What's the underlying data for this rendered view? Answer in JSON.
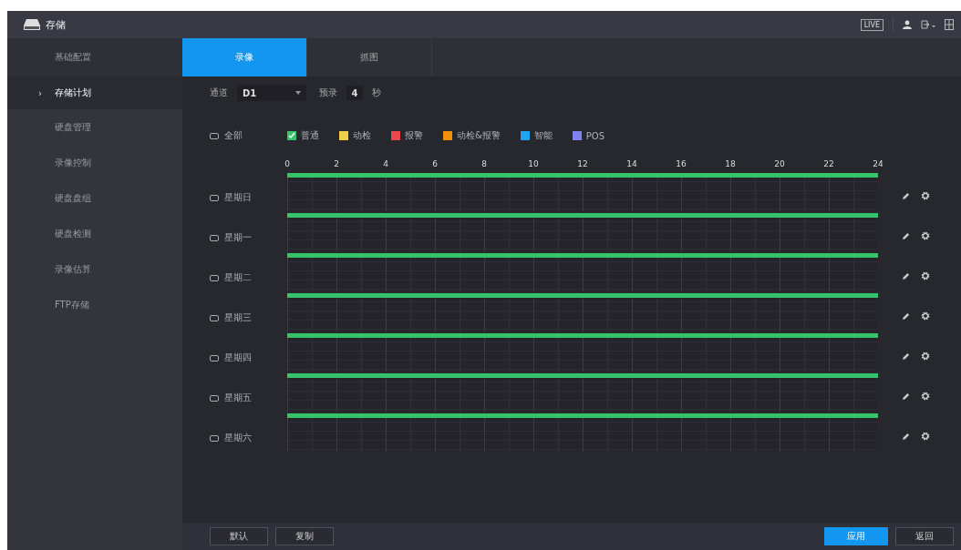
{
  "header": {
    "title": "存储",
    "live_label": "LIVE"
  },
  "sidebar": {
    "selected_marker": "›",
    "items": [
      {
        "label": "基础配置",
        "selected": false
      },
      {
        "label": "存储计划",
        "selected": true
      },
      {
        "label": "硬盘管理",
        "selected": false
      },
      {
        "label": "录像控制",
        "selected": false
      },
      {
        "label": "硬盘盘组",
        "selected": false
      },
      {
        "label": "硬盘检测",
        "selected": false
      },
      {
        "label": "录像估算",
        "selected": false
      },
      {
        "label": "FTP存储",
        "selected": false
      }
    ]
  },
  "tabs": [
    {
      "label": "录像",
      "selected": true
    },
    {
      "label": "抓图",
      "selected": false
    }
  ],
  "channel": {
    "label": "通道",
    "value": "D1",
    "prerecord_label": "预录",
    "prerecord_value": "4",
    "unit": "秒"
  },
  "select_all": {
    "label": "全部",
    "checked": false
  },
  "legend": [
    {
      "label": "普通",
      "color": "#35c46a",
      "checked": true
    },
    {
      "label": "动检",
      "color": "#f0cf4a",
      "checked": false
    },
    {
      "label": "报警",
      "color": "#e8474c",
      "checked": false
    },
    {
      "label": "动检&报警",
      "color": "#f2900c",
      "checked": false
    },
    {
      "label": "智能",
      "color": "#1ea4f0",
      "checked": false
    },
    {
      "label": "POS",
      "color": "#7f82f2",
      "checked": false
    }
  ],
  "axis_labels": [
    "0",
    "2",
    "4",
    "6",
    "8",
    "10",
    "12",
    "14",
    "16",
    "18",
    "20",
    "22",
    "24"
  ],
  "days": [
    {
      "label": "星期日",
      "checked": false,
      "level": 1
    },
    {
      "label": "星期一",
      "checked": false,
      "level": 1
    },
    {
      "label": "星期二",
      "checked": false,
      "level": 1
    },
    {
      "label": "星期三",
      "checked": false,
      "level": 1
    },
    {
      "label": "星期四",
      "checked": false,
      "level": 1
    },
    {
      "label": "星期五",
      "checked": false,
      "level": 1
    },
    {
      "label": "星期六",
      "checked": false,
      "level": 1
    }
  ],
  "buttons_left": [
    {
      "label": "默认",
      "primary": false
    },
    {
      "label": "复制",
      "primary": false
    }
  ],
  "buttons_right": [
    {
      "label": "应用",
      "primary": true
    },
    {
      "label": "返回",
      "primary": false
    }
  ]
}
